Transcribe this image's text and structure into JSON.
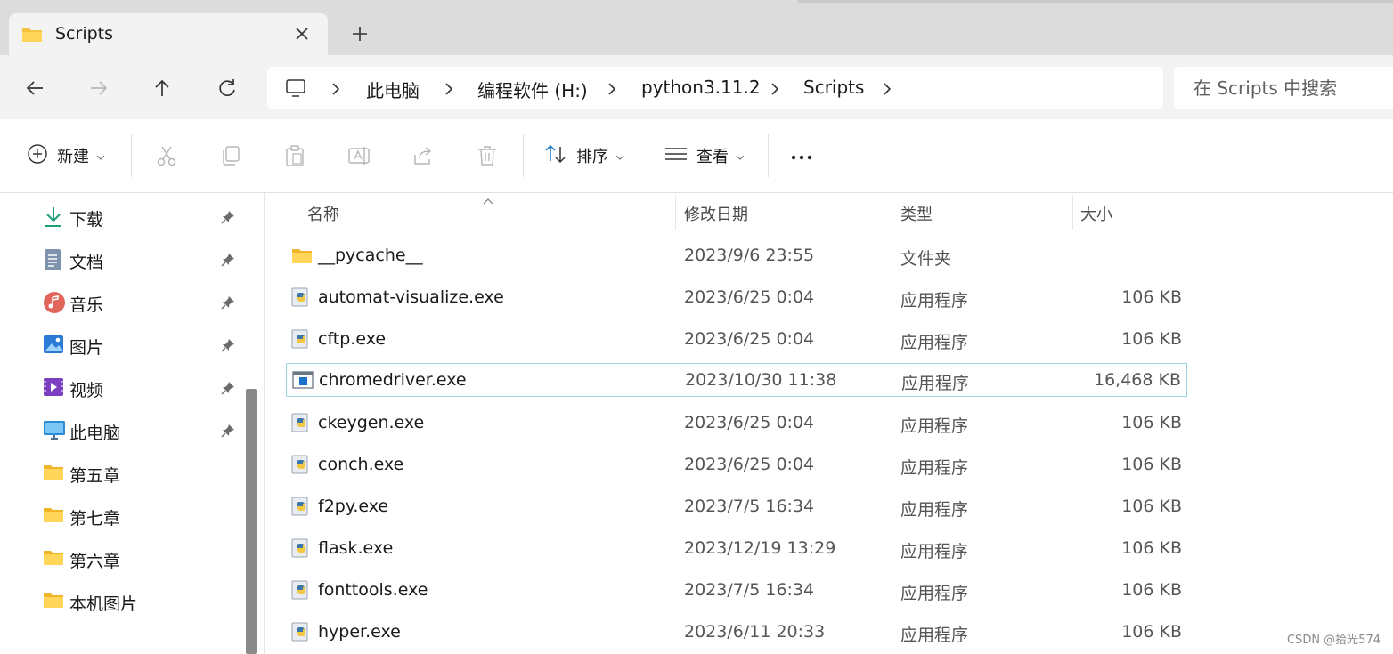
{
  "tab": {
    "title": "Scripts"
  },
  "breadcrumbs": [
    "此电脑",
    "编程软件 (H:)",
    "python3.11.2",
    "Scripts"
  ],
  "search": {
    "placeholder": "在 Scripts 中搜索"
  },
  "toolbar": {
    "new_label": "新建",
    "sort_label": "排序",
    "view_label": "查看"
  },
  "sidebar": {
    "items": [
      {
        "label": "下载",
        "icon": "download-icon",
        "pinned": true
      },
      {
        "label": "文档",
        "icon": "document-icon",
        "pinned": true
      },
      {
        "label": "音乐",
        "icon": "music-icon",
        "pinned": true
      },
      {
        "label": "图片",
        "icon": "pictures-icon",
        "pinned": true
      },
      {
        "label": "视频",
        "icon": "video-icon",
        "pinned": true
      },
      {
        "label": "此电脑",
        "icon": "computer-icon",
        "pinned": true
      },
      {
        "label": "第五章",
        "icon": "folder-icon",
        "pinned": false
      },
      {
        "label": "第七章",
        "icon": "folder-icon",
        "pinned": false
      },
      {
        "label": "第六章",
        "icon": "folder-icon",
        "pinned": false
      },
      {
        "label": "本机图片",
        "icon": "folder-icon",
        "pinned": false
      }
    ]
  },
  "columns": {
    "name": "名称",
    "modified": "修改日期",
    "type": "类型",
    "size": "大小"
  },
  "files": [
    {
      "name": "__pycache__",
      "modified": "2023/9/6 23:55",
      "type": "文件夹",
      "size": "",
      "icon": "folder-icon"
    },
    {
      "name": "automat-visualize.exe",
      "modified": "2023/6/25 0:04",
      "type": "应用程序",
      "size": "106 KB",
      "icon": "python-exe-icon"
    },
    {
      "name": "cftp.exe",
      "modified": "2023/6/25 0:04",
      "type": "应用程序",
      "size": "106 KB",
      "icon": "python-exe-icon"
    },
    {
      "name": "chromedriver.exe",
      "modified": "2023/10/30 11:38",
      "type": "应用程序",
      "size": "16,468 KB",
      "icon": "exe-window-icon",
      "selected": true
    },
    {
      "name": "ckeygen.exe",
      "modified": "2023/6/25 0:04",
      "type": "应用程序",
      "size": "106 KB",
      "icon": "python-exe-icon"
    },
    {
      "name": "conch.exe",
      "modified": "2023/6/25 0:04",
      "type": "应用程序",
      "size": "106 KB",
      "icon": "python-exe-icon"
    },
    {
      "name": "f2py.exe",
      "modified": "2023/7/5 16:34",
      "type": "应用程序",
      "size": "106 KB",
      "icon": "python-exe-icon"
    },
    {
      "name": "flask.exe",
      "modified": "2023/12/19 13:29",
      "type": "应用程序",
      "size": "106 KB",
      "icon": "python-exe-icon"
    },
    {
      "name": "fonttools.exe",
      "modified": "2023/7/5 16:34",
      "type": "应用程序",
      "size": "106 KB",
      "icon": "python-exe-icon"
    },
    {
      "name": "hyper.exe",
      "modified": "2023/6/11 20:33",
      "type": "应用程序",
      "size": "106 KB",
      "icon": "python-exe-icon"
    }
  ],
  "watermark": "CSDN @拾光574",
  "colors": {
    "accent": "#1a73c8",
    "selection_border": "#9fd3ec",
    "folder": "#f5c342"
  }
}
